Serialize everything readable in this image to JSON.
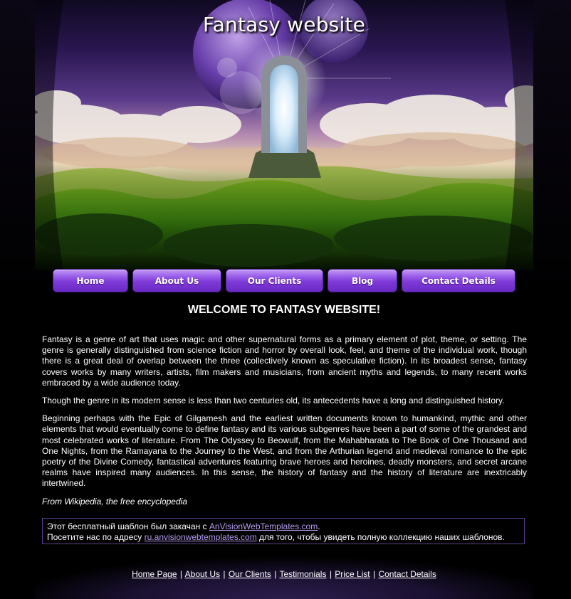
{
  "header": {
    "title": "Fantasy website"
  },
  "nav": {
    "items": [
      {
        "label": "Home"
      },
      {
        "label": "About Us"
      },
      {
        "label": "Our Clients"
      },
      {
        "label": "Blog"
      },
      {
        "label": "Contact Details"
      }
    ]
  },
  "main": {
    "heading": "WELCOME TO FANTASY WEBSITE!",
    "paragraphs": [
      "Fantasy is a genre of art that uses magic and other supernatural forms as a primary element of plot, theme, or setting. The genre is generally distinguished from science fiction and horror by overall look, feel, and theme of the individual work, though there is a great deal of overlap between the three (collectively known as speculative fiction). In its broadest sense, fantasy covers works by many writers, artists, film makers and musicians, from ancient myths and legends, to many recent works embraced by a wide audience today.",
      "Though the genre in its modern sense is less than two centuries old, its antecedents have a long and distinguished history.",
      "Beginning perhaps with the Epic of Gilgamesh and the earliest written documents known to humankind, mythic and other elements that would eventually come to define fantasy and its various subgenres have been a part of some of the grandest and most celebrated works of literature. From The Odyssey to Beowulf, from the Mahabharata to The Book of One Thousand and One Nights, from the Ramayana to the Journey to the West, and from the Arthurian legend and medieval romance to the epic poetry of the Divine Comedy, fantastical adventures featuring brave heroes and heroines, deadly monsters, and secret arcane realms have inspired many audiences. In this sense, the history of fantasy and the history of literature are inextricably intertwined."
    ],
    "source": "From Wikipedia, the free encyclopedia"
  },
  "notice": {
    "line1_text": "Этот бесплатный шаблон был закачан с ",
    "line1_link": "AnVisionWebTemplates.com",
    "line1_end": ".",
    "line2_text": "Посетите нас по адресу ",
    "line2_link": "ru.anvisionwebtemplates.com",
    "line2_end": " для того, чтобы увидеть полную коллекцию наших шаблонов."
  },
  "footer": {
    "links": [
      "Home Page",
      "About Us",
      "Our Clients",
      "Testimonials",
      "Price List",
      "Contact Details"
    ],
    "separator": "|"
  },
  "colors": {
    "accent": "#7e3ad8",
    "link": "#b59cf0",
    "background": "#000000",
    "notice_border": "#5b3f8a"
  }
}
